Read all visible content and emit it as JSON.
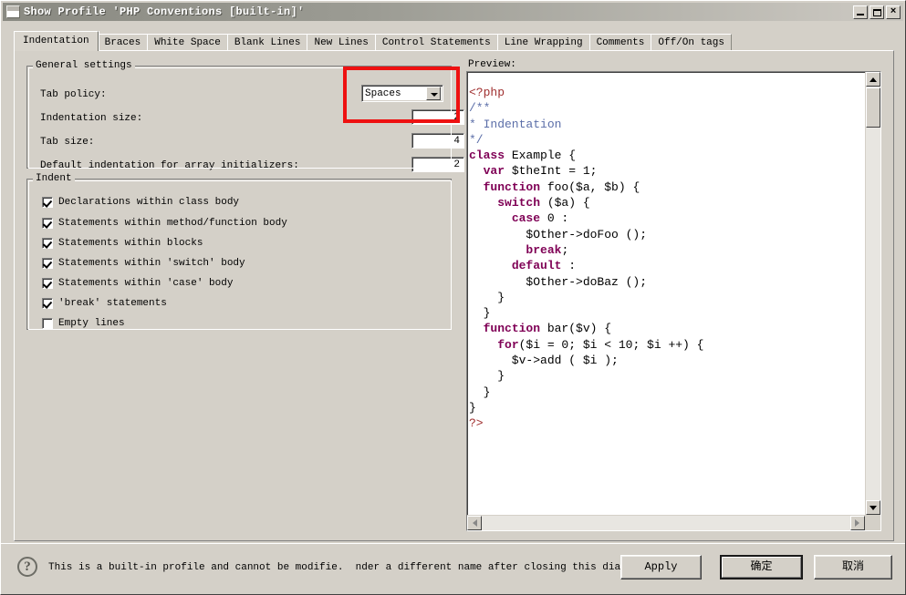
{
  "window": {
    "title": "Show Profile 'PHP Conventions [built-in]'",
    "icon": "window-icon",
    "minimize_label": "_",
    "maximize_label": "□",
    "close_label": "×"
  },
  "tabs": [
    {
      "label": "Indentation",
      "selected": true
    },
    {
      "label": "Braces",
      "selected": false
    },
    {
      "label": "White Space",
      "selected": false
    },
    {
      "label": "Blank Lines",
      "selected": false
    },
    {
      "label": "New Lines",
      "selected": false
    },
    {
      "label": "Control Statements",
      "selected": false
    },
    {
      "label": "Line Wrapping",
      "selected": false
    },
    {
      "label": "Comments",
      "selected": false
    },
    {
      "label": "Off/On tags",
      "selected": false
    }
  ],
  "general_settings": {
    "title": "General settings",
    "tab_policy": {
      "label": "Tab policy:",
      "value": "Spaces"
    },
    "indentation_size": {
      "label": "Indentation size:",
      "value": "2"
    },
    "tab_size": {
      "label": "Tab size:",
      "value": "4"
    },
    "array_initializers": {
      "label": "Default indentation for array initializers:",
      "value": "2"
    }
  },
  "indent": {
    "title": "Indent",
    "options": [
      {
        "label": "Declarations within class body",
        "checked": true
      },
      {
        "label": "Statements within method/function body",
        "checked": true
      },
      {
        "label": "Statements within blocks",
        "checked": true
      },
      {
        "label": "Statements within 'switch' body",
        "checked": true
      },
      {
        "label": "Statements within 'case' body",
        "checked": true
      },
      {
        "label": "'break' statements",
        "checked": true
      },
      {
        "label": "Empty lines",
        "checked": false
      }
    ]
  },
  "preview": {
    "label": "Preview:",
    "code_lines": [
      {
        "text": "<?php",
        "cls": "ph"
      },
      {
        "text": "/**",
        "cls": "cm"
      },
      {
        "text": "* Indentation",
        "cls": "cm"
      },
      {
        "text": "*/",
        "cls": "cm"
      },
      {
        "text": "class Example {",
        "cls": ""
      },
      {
        "text": "  var $theInt = 1;",
        "cls": ""
      },
      {
        "text": "  function foo($a, $b) {",
        "cls": ""
      },
      {
        "text": "    switch ($a) {",
        "cls": ""
      },
      {
        "text": "      case 0 :",
        "cls": ""
      },
      {
        "text": "        $Other->doFoo ();",
        "cls": ""
      },
      {
        "text": "        break;",
        "cls": ""
      },
      {
        "text": "      default :",
        "cls": ""
      },
      {
        "text": "        $Other->doBaz ();",
        "cls": ""
      },
      {
        "text": "    }",
        "cls": ""
      },
      {
        "text": "  }",
        "cls": ""
      },
      {
        "text": "  function bar($v) {",
        "cls": ""
      },
      {
        "text": "    for($i = 0; $i < 10; $i ++) {",
        "cls": ""
      },
      {
        "text": "      $v->add ( $i );",
        "cls": ""
      },
      {
        "text": "    }",
        "cls": ""
      },
      {
        "text": "  }",
        "cls": ""
      },
      {
        "text": "}",
        "cls": ""
      },
      {
        "text": "?>",
        "cls": "ph"
      }
    ]
  },
  "footer": {
    "help_icon_label": "?",
    "status": "This is a built-in profile and cannot be modifie.  nder a different name after closing this dialog.",
    "apply_label": "Apply",
    "ok_label": "确定",
    "cancel_label": "取消"
  },
  "annotation": {
    "color": "#ee1111",
    "target": "tab-policy-and-indentation-size"
  }
}
